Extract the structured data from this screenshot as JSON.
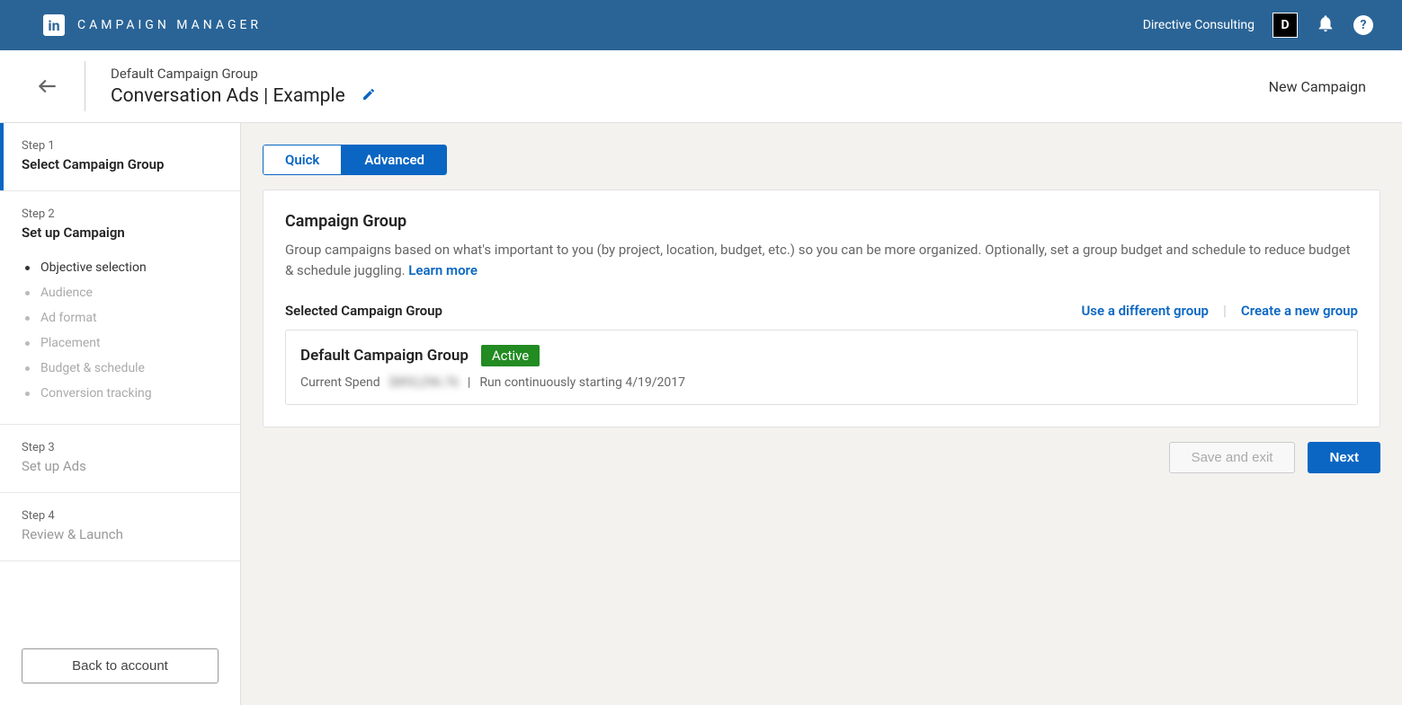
{
  "topNav": {
    "appTitle": "CAMPAIGN MANAGER",
    "accountName": "Directive Consulting",
    "avatarInitial": "D"
  },
  "subHeader": {
    "breadcrumb": "Default Campaign Group",
    "campaignTitle": "Conversation Ads | Example",
    "newCampaign": "New Campaign"
  },
  "sidebar": {
    "steps": [
      {
        "num": "Step 1",
        "title": "Select Campaign Group"
      },
      {
        "num": "Step 2",
        "title": "Set up Campaign"
      },
      {
        "num": "Step 3",
        "title": "Set up Ads"
      },
      {
        "num": "Step 4",
        "title": "Review & Launch"
      }
    ],
    "substeps": [
      "Objective selection",
      "Audience",
      "Ad format",
      "Placement",
      "Budget & schedule",
      "Conversion tracking"
    ],
    "backButton": "Back to account"
  },
  "toggle": {
    "quick": "Quick",
    "advanced": "Advanced"
  },
  "card": {
    "heading": "Campaign Group",
    "description": "Group campaigns based on what's important to you (by project, location, budget, etc.) so you can be more organized. Optionally, set a group budget and schedule to reduce budget & schedule juggling. ",
    "learnMore": "Learn more",
    "selectedLabel": "Selected Campaign Group",
    "useDifferent": "Use a different group",
    "createNew": "Create a new group",
    "groupName": "Default Campaign Group",
    "status": "Active",
    "spendLabel": "Current Spend",
    "spendValue": "$893,296.76",
    "schedule": "Run continuously starting 4/19/2017"
  },
  "footer": {
    "saveExit": "Save and exit",
    "next": "Next"
  }
}
